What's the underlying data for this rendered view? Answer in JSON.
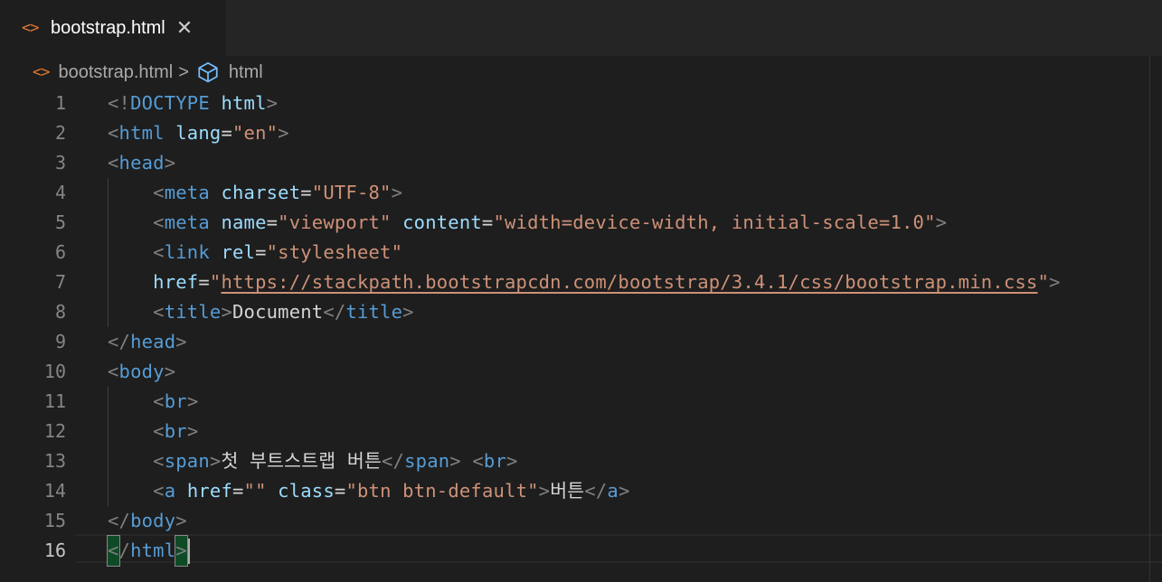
{
  "tab": {
    "icon": "<>",
    "label": "bootstrap.html",
    "close": "✕"
  },
  "breadcrumb": {
    "file_icon": "<>",
    "file": "bootstrap.html",
    "separator": ">",
    "symbol": "html",
    "symbol_icon": "cube-icon"
  },
  "editor": {
    "line_numbers": [
      "1",
      "2",
      "3",
      "4",
      "5",
      "6",
      "7",
      "8",
      "9",
      "10",
      "11",
      "12",
      "13",
      "14",
      "15",
      "16"
    ],
    "lines": [
      "<!DOCTYPE html>",
      "<html lang=\"en\">",
      "<head>",
      "    <meta charset=\"UTF-8\">",
      "    <meta name=\"viewport\" content=\"width=device-width, initial-scale=1.0\">",
      "    <link rel=\"stylesheet\"",
      "    href=\"https://stackpath.bootstrapcdn.com/bootstrap/3.4.1/css/bootstrap.min.css\">",
      "    <title>Document</title>",
      "</head>",
      "<body>",
      "    <br>",
      "    <br>",
      "    <span>첫 부트스트랩 버튼</span> <br>",
      "    <a href=\"\" class=\"btn btn-default\">버튼</a>",
      "</body>",
      "</html>"
    ],
    "active_line": "16"
  },
  "colors": {
    "background": "#1e1e1e",
    "tag": "#569cd6",
    "attribute": "#9cdcfe",
    "string": "#ce9178",
    "bracket": "#808080",
    "text": "#d4d4d4",
    "file_icon": "#e37933"
  }
}
